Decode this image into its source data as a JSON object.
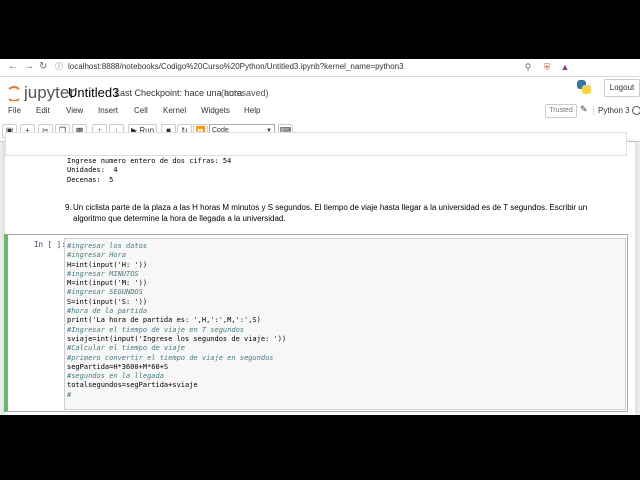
{
  "browser": {
    "url": "localhost:8888/notebooks/Codigo%20Curso%20Python/Untitled3.ipynb?kernel_name=python3"
  },
  "header": {
    "logo": "jupyter",
    "notebook_name": "Untitled3",
    "checkpoint": "Last Checkpoint: hace una hora",
    "autosaved": "(autosaved)",
    "logout": "Logout"
  },
  "menubar": {
    "items": [
      "File",
      "Edit",
      "View",
      "Insert",
      "Cell",
      "Kernel",
      "Widgets",
      "Help"
    ],
    "trusted": "Trusted",
    "kernel": "Python 3"
  },
  "toolbar": {
    "run_label": "Run",
    "cell_type": "Code"
  },
  "output": {
    "lines": [
      "Ingrese numero entero de dos cifras: 54",
      "Unidades:  4",
      "Decenas:  5"
    ]
  },
  "markdown": {
    "number": "9.",
    "text": "Un ciclista parte de la plaza a las H horas M minutos y S segundos. El tiempo de viaje hasta llegar a la universidad es de T segundos. Escribir un algoritmo que determine la hora de llegada a la universidad."
  },
  "cell": {
    "prompt": "In [ ]:",
    "code_lines": [
      {
        "t": "#ingresar los datos",
        "c": true
      },
      {
        "t": "#ingresar Hora",
        "c": true
      },
      {
        "t": "H=int(input('H: '))",
        "c": false
      },
      {
        "t": "#ingresar MINUTOS",
        "c": true
      },
      {
        "t": "M=int(input('M: '))",
        "c": false
      },
      {
        "t": "#ingresar SEGUNDOS",
        "c": true
      },
      {
        "t": "S=int(input('S: '))",
        "c": false
      },
      {
        "t": "#hora de la partida",
        "c": true
      },
      {
        "t": "print('La hora de partida es: ',H,':',M,':',S)",
        "c": false
      },
      {
        "t": "#Ingresar el tiempo de viaje en T segundos",
        "c": true
      },
      {
        "t": "sviaje=int(input('Ingrese los segundos de viaje: '))",
        "c": false
      },
      {
        "t": "#Calcular el tiempo de viaje",
        "c": true
      },
      {
        "t": "#primero convertir el tiempo de viaje en segundos",
        "c": true
      },
      {
        "t": "segPartida=H*3600+M*60+S",
        "c": false
      },
      {
        "t": "#segundos en la llegada",
        "c": true
      },
      {
        "t": "totalsegundos=segPartida+sviaje",
        "c": false
      },
      {
        "t": "#",
        "c": true
      }
    ]
  }
}
